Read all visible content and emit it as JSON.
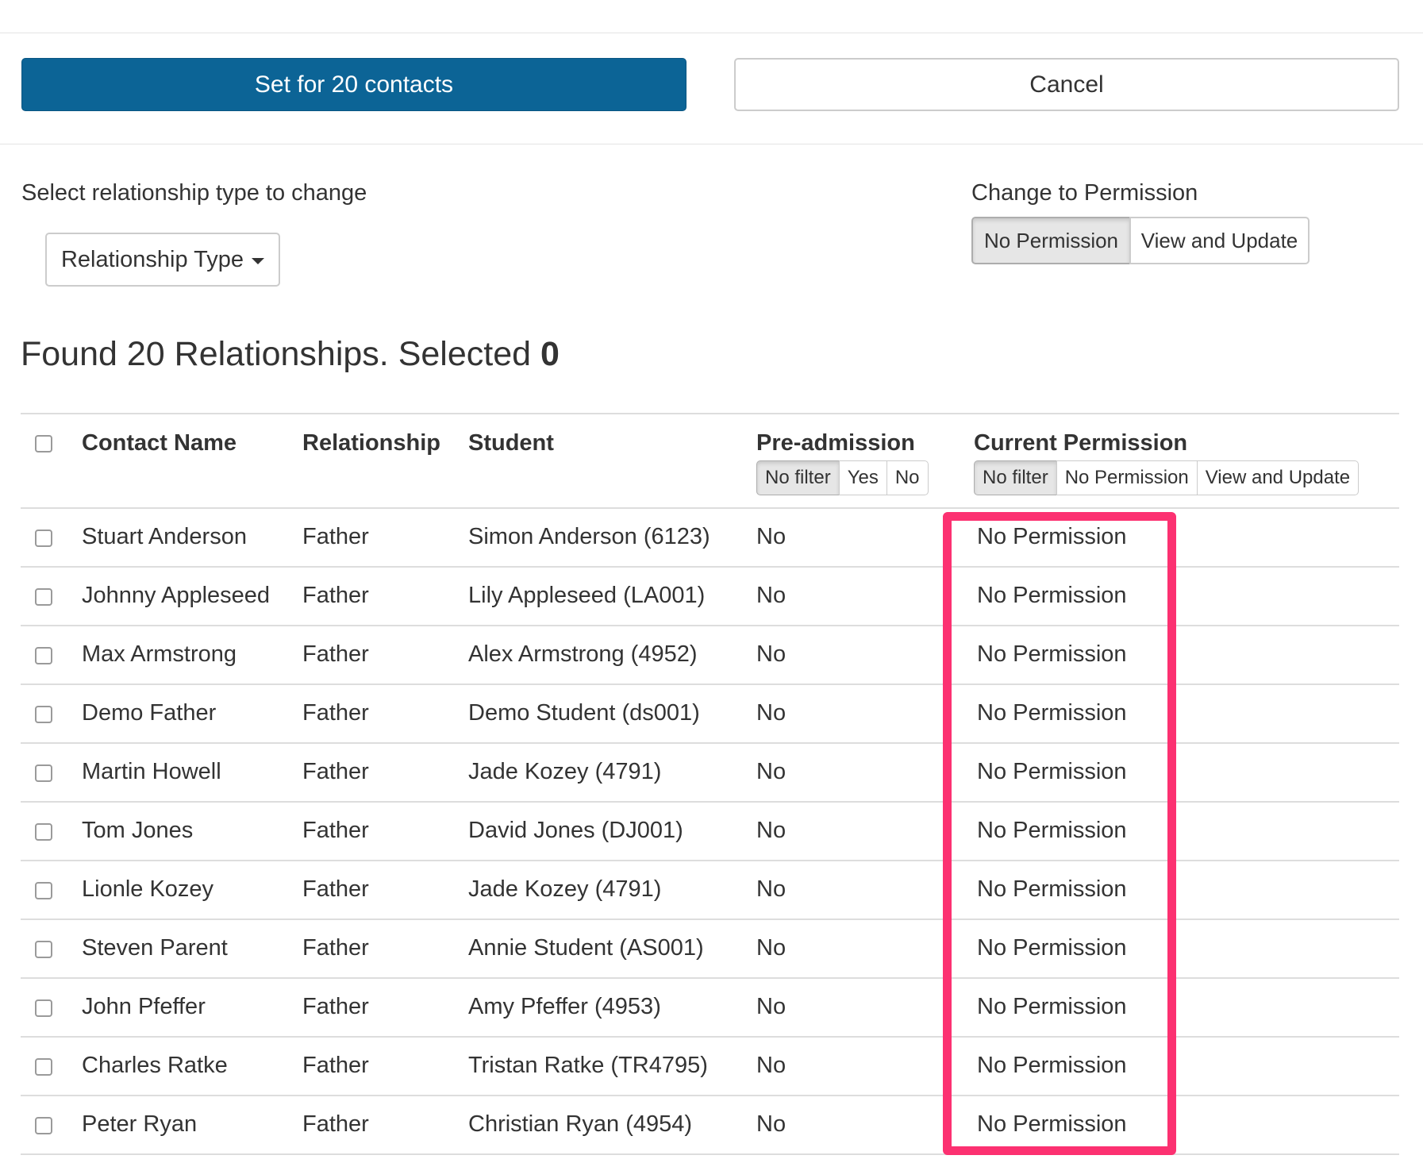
{
  "toolbar": {
    "set_button_label": "Set for 20 contacts",
    "cancel_button_label": "Cancel"
  },
  "relationship_select": {
    "label": "Select relationship type to change",
    "dropdown_label": "Relationship Type"
  },
  "change_permission": {
    "label": "Change to Permission",
    "options": [
      "No Permission",
      "View and Update"
    ],
    "selected": "No Permission"
  },
  "summary": {
    "found_text": "Found 20 Relationships. Selected",
    "selected_count": "0"
  },
  "table": {
    "headers": {
      "contact_name": "Contact Name",
      "relationship": "Relationship",
      "student": "Student",
      "pre_admission": "Pre-admission",
      "current_permission": "Current Permission"
    },
    "pre_admission_filter": {
      "options": [
        "No filter",
        "Yes",
        "No"
      ],
      "selected": "No filter"
    },
    "permission_filter": {
      "options": [
        "No filter",
        "No Permission",
        "View and Update"
      ],
      "selected": "No filter"
    },
    "rows": [
      {
        "contact": "Stuart Anderson",
        "relationship": "Father",
        "student": "Simon Anderson (6123)",
        "pre_admission": "No",
        "permission": "No Permission"
      },
      {
        "contact": "Johnny Appleseed",
        "relationship": "Father",
        "student": "Lily Appleseed (LA001)",
        "pre_admission": "No",
        "permission": "No Permission"
      },
      {
        "contact": "Max Armstrong",
        "relationship": "Father",
        "student": "Alex Armstrong (4952)",
        "pre_admission": "No",
        "permission": "No Permission"
      },
      {
        "contact": "Demo Father",
        "relationship": "Father",
        "student": "Demo Student (ds001)",
        "pre_admission": "No",
        "permission": "No Permission"
      },
      {
        "contact": "Martin Howell",
        "relationship": "Father",
        "student": "Jade Kozey (4791)",
        "pre_admission": "No",
        "permission": "No Permission"
      },
      {
        "contact": "Tom Jones",
        "relationship": "Father",
        "student": "David Jones (DJ001)",
        "pre_admission": "No",
        "permission": "No Permission"
      },
      {
        "contact": "Lionle Kozey",
        "relationship": "Father",
        "student": "Jade Kozey (4791)",
        "pre_admission": "No",
        "permission": "No Permission"
      },
      {
        "contact": "Steven Parent",
        "relationship": "Father",
        "student": "Annie Student (AS001)",
        "pre_admission": "No",
        "permission": "No Permission"
      },
      {
        "contact": "John Pfeffer",
        "relationship": "Father",
        "student": "Amy Pfeffer (4953)",
        "pre_admission": "No",
        "permission": "No Permission"
      },
      {
        "contact": "Charles Ratke",
        "relationship": "Father",
        "student": "Tristan Ratke (TR4795)",
        "pre_admission": "No",
        "permission": "No Permission"
      },
      {
        "contact": "Peter Ryan",
        "relationship": "Father",
        "student": "Christian Ryan (4954)",
        "pre_admission": "No",
        "permission": "No Permission"
      }
    ]
  },
  "colors": {
    "primary": "#0c6496",
    "highlight": "#fc3171",
    "border": "#cccccc"
  }
}
